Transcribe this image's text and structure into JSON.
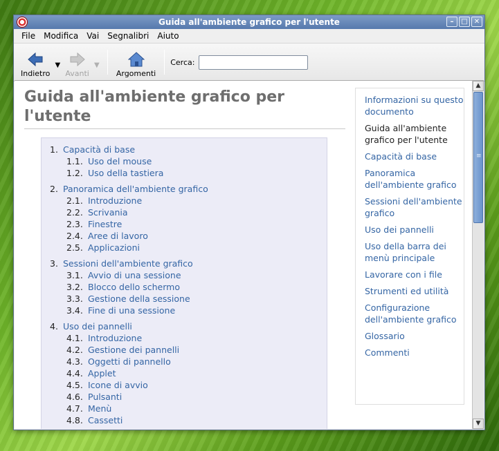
{
  "window": {
    "title": "Guida all'ambiente grafico per l'utente"
  },
  "menubar": [
    {
      "label": "File"
    },
    {
      "label": "Modifica"
    },
    {
      "label": "Vai"
    },
    {
      "label": "Segnalibri"
    },
    {
      "label": "Aiuto"
    }
  ],
  "toolbar": {
    "back_label": "Indietro",
    "forward_label": "Avanti",
    "contents_label": "Argomenti",
    "search_label": "Cerca:",
    "search_value": ""
  },
  "document": {
    "title": "Guida all'ambiente grafico per l'utente",
    "toc": [
      {
        "num": "1.",
        "label": "Capacità di base",
        "items": [
          {
            "num": "1.1.",
            "label": "Uso del mouse"
          },
          {
            "num": "1.2.",
            "label": "Uso della tastiera"
          }
        ]
      },
      {
        "num": "2.",
        "label": "Panoramica dell'ambiente grafico",
        "items": [
          {
            "num": "2.1.",
            "label": "Introduzione"
          },
          {
            "num": "2.2.",
            "label": "Scrivania"
          },
          {
            "num": "2.3.",
            "label": "Finestre"
          },
          {
            "num": "2.4.",
            "label": "Aree di lavoro"
          },
          {
            "num": "2.5.",
            "label": "Applicazioni"
          }
        ]
      },
      {
        "num": "3.",
        "label": "Sessioni dell'ambiente grafico",
        "items": [
          {
            "num": "3.1.",
            "label": "Avvio di una sessione"
          },
          {
            "num": "3.2.",
            "label": "Blocco dello schermo"
          },
          {
            "num": "3.3.",
            "label": "Gestione della sessione"
          },
          {
            "num": "3.4.",
            "label": "Fine di una sessione"
          }
        ]
      },
      {
        "num": "4.",
        "label": "Uso dei pannelli",
        "items": [
          {
            "num": "4.1.",
            "label": "Introduzione"
          },
          {
            "num": "4.2.",
            "label": "Gestione dei pannelli"
          },
          {
            "num": "4.3.",
            "label": "Oggetti di pannello"
          },
          {
            "num": "4.4.",
            "label": "Applet"
          },
          {
            "num": "4.5.",
            "label": "Icone di avvio"
          },
          {
            "num": "4.6.",
            "label": "Pulsanti"
          },
          {
            "num": "4.7.",
            "label": "Menù"
          },
          {
            "num": "4.8.",
            "label": "Cassetti"
          }
        ]
      }
    ]
  },
  "sidebar": [
    {
      "label": "Informazioni su questo documento",
      "current": false
    },
    {
      "label": "Guida all'ambiente grafico per l'utente",
      "current": true
    },
    {
      "label": "Capacità di base",
      "current": false
    },
    {
      "label": "Panoramica dell'ambiente grafico",
      "current": false
    },
    {
      "label": "Sessioni dell'ambiente grafico",
      "current": false
    },
    {
      "label": "Uso dei pannelli",
      "current": false
    },
    {
      "label": "Uso della barra dei menù principale",
      "current": false
    },
    {
      "label": "Lavorare con i file",
      "current": false
    },
    {
      "label": "Strumenti ed utilità",
      "current": false
    },
    {
      "label": "Configurazione dell'ambiente grafico",
      "current": false
    },
    {
      "label": "Glossario",
      "current": false
    },
    {
      "label": "Commenti",
      "current": false
    }
  ],
  "colors": {
    "link": "#3465a4",
    "titlebar": "#5679ad",
    "toc_background": "#ececf7"
  }
}
